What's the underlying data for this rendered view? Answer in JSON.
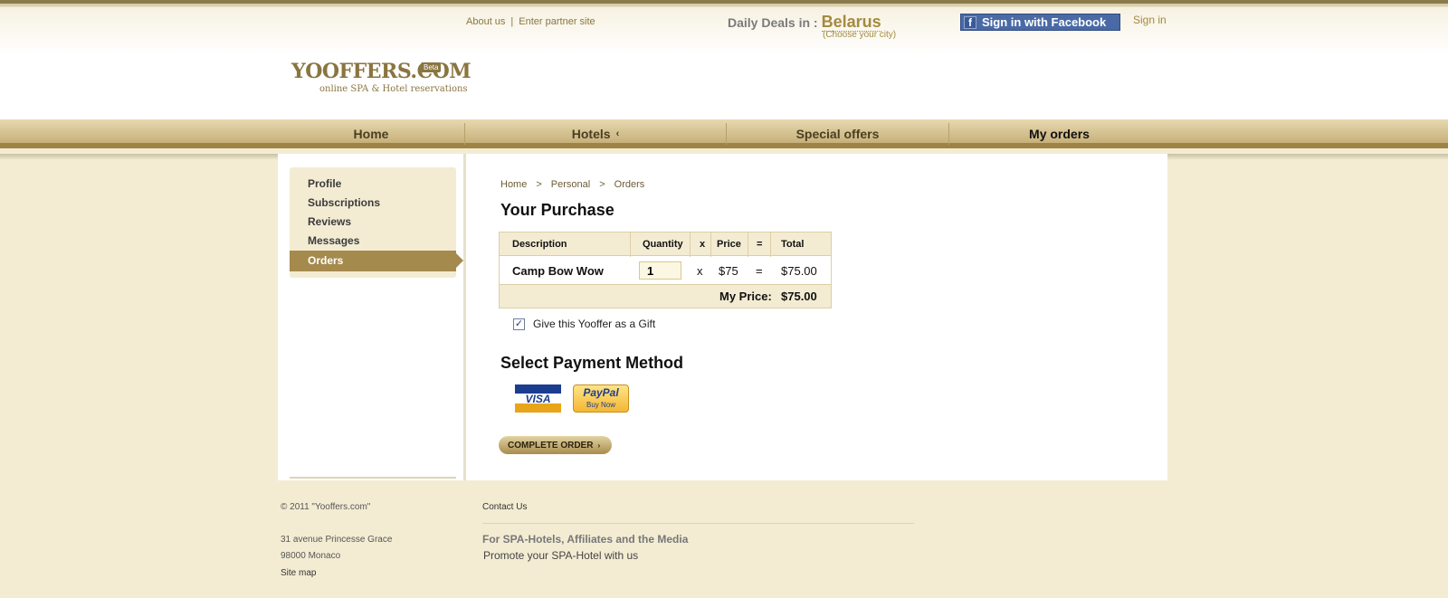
{
  "header": {
    "about_us": "About us",
    "separator": "|",
    "partner_site": "Enter partner site",
    "deals_label": "Daily Deals in :",
    "country": "Belarus",
    "choose_city": "(Choose your city)",
    "facebook_button": "Sign in with Facebook",
    "sign_in": "Sign in",
    "logo": "YOOFFERS.COM",
    "logo_badge": "Beta",
    "logo_tagline": "online SPA & Hotel reservations"
  },
  "nav": {
    "items": [
      {
        "label": "Home"
      },
      {
        "label": "Hotels",
        "caret": "‹"
      },
      {
        "label": "Special offers"
      },
      {
        "label": "My orders"
      }
    ]
  },
  "sidebar": {
    "items": [
      {
        "label": "Profile"
      },
      {
        "label": "Subscriptions"
      },
      {
        "label": "Reviews"
      },
      {
        "label": "Messages"
      },
      {
        "label": "Orders"
      }
    ]
  },
  "breadcrumb": {
    "items": [
      "Home",
      "Personal",
      "Orders"
    ],
    "separator": ">"
  },
  "purchase": {
    "title": "Your Purchase",
    "headers": {
      "description": "Description",
      "quantity": "Quantity",
      "times": "x",
      "price": "Price",
      "equals": "=",
      "total": "Total"
    },
    "row": {
      "description": "Camp Bow Wow",
      "quantity": "1",
      "times": "x",
      "price": "$75",
      "equals": "=",
      "total": "$75.00"
    },
    "my_price_label": "My Price:",
    "my_price_value": "$75.00",
    "gift_label": "Give this Yooffer as a Gift",
    "gift_checked": "✓"
  },
  "payment": {
    "title": "Select Payment Method",
    "visa": "VISA",
    "paypal": "PayPal",
    "paypal_sub": "Buy Now",
    "complete_button": "COMPLETE ORDER",
    "complete_arrow": "›"
  },
  "footer": {
    "copyright": "© 2011 \"Yooffers.com\"",
    "address1": "31 avenue Princesse Grace",
    "address2": "98000 Monaco",
    "site_map": "Site map",
    "contact": "Contact Us",
    "partners_heading": "For SPA-Hotels, Affiliates and the Media",
    "promote": "Promote your SPA-Hotel with us"
  },
  "colors": {
    "brand_gold": "#a58a3f",
    "nav_dark": "#9d8445",
    "page_bg": "#f3ecd3",
    "facebook_blue": "#4a6aa6"
  }
}
